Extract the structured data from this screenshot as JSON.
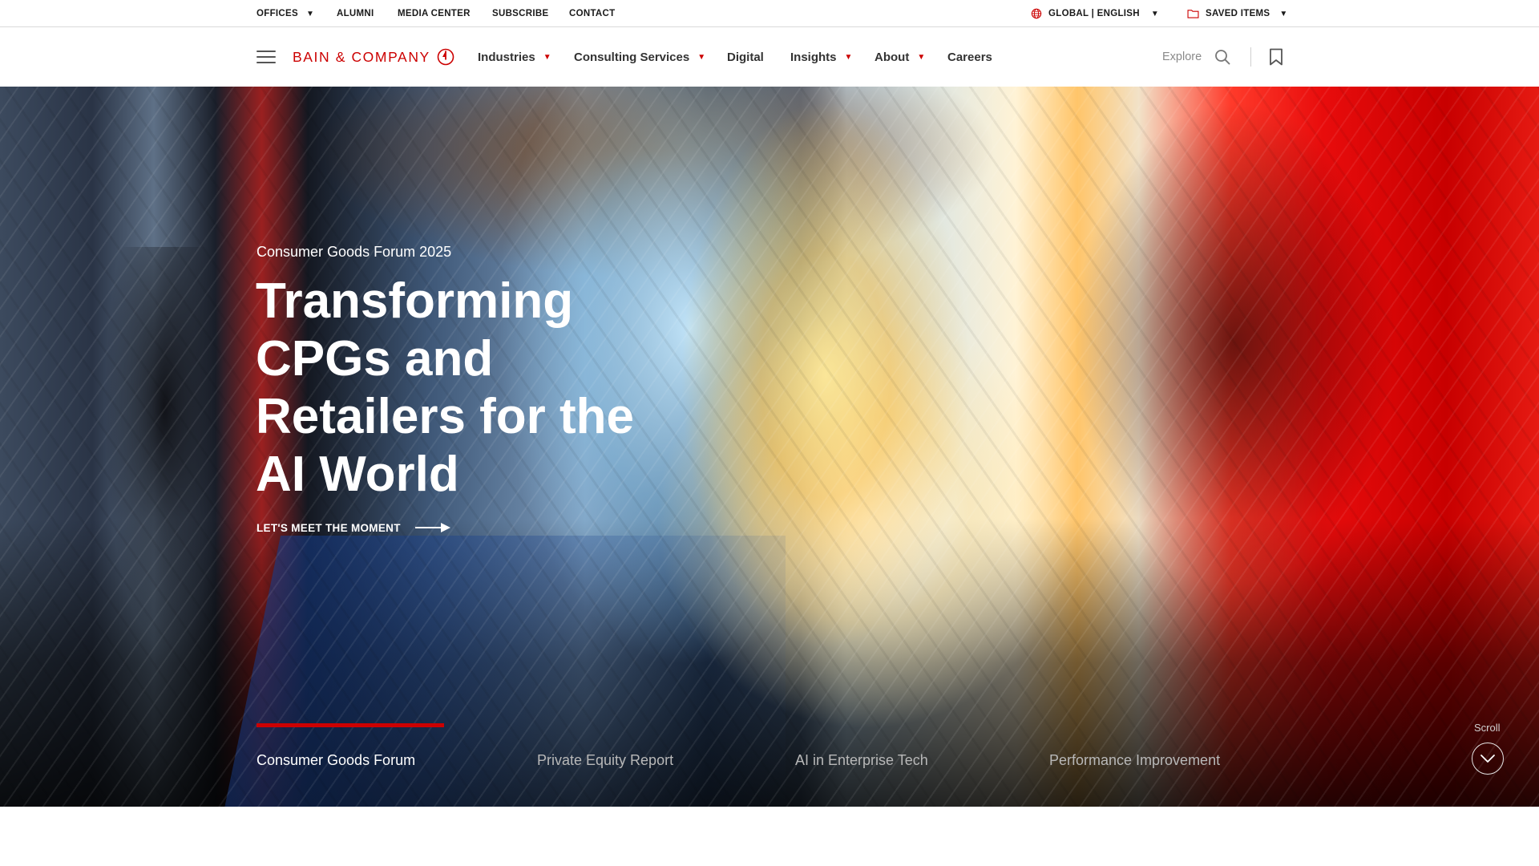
{
  "utility": {
    "offices": "OFFICES",
    "alumni": "ALUMNI",
    "media_center": "MEDIA CENTER",
    "subscribe": "SUBSCRIBE",
    "contact": "CONTACT",
    "language": "GLOBAL | ENGLISH",
    "saved_items": "SAVED ITEMS"
  },
  "nav": {
    "logo": "BAIN & COMPANY",
    "industries": "Industries",
    "consulting_services": "Consulting Services",
    "digital": "Digital",
    "insights": "Insights",
    "about": "About",
    "careers": "Careers",
    "explore": "Explore"
  },
  "hero": {
    "eyebrow": "Consumer Goods Forum 2025",
    "title": "Transforming CPGs and Retailers for the AI World",
    "cta": "LET'S MEET THE MOMENT",
    "tabs": [
      {
        "label": "Consumer Goods Forum",
        "active": true
      },
      {
        "label": "Private Equity Report",
        "active": false
      },
      {
        "label": "AI in Enterprise Tech",
        "active": false
      },
      {
        "label": "Performance Improvement",
        "active": false
      }
    ],
    "scroll_label": "Scroll"
  },
  "colors": {
    "brand_red": "#cc0000",
    "text_dark": "#1a1a1a",
    "hero_text": "#ffffff"
  },
  "icons": [
    "menu-icon",
    "logo-mark-icon",
    "globe-icon",
    "folder-icon",
    "search-icon",
    "bookmark-icon",
    "arrow-right-icon",
    "chevron-down-icon"
  ]
}
